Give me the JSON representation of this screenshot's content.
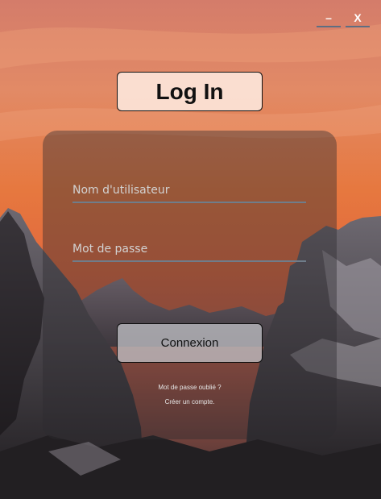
{
  "window": {
    "minimize_label": "–",
    "close_label": "X"
  },
  "title": "Log In",
  "form": {
    "username_placeholder": "Nom d'utilisateur",
    "password_placeholder": "Mot de passe",
    "submit_label": "Connexion",
    "forgot_password": "Mot de passe oublié ?",
    "create_account": "Créer un compte."
  },
  "colors": {
    "sky_top": "#d9846a",
    "sky_mid": "#e97a43",
    "mountain_dark": "#2e2a2d",
    "field_underline": "#6f7d8a"
  }
}
